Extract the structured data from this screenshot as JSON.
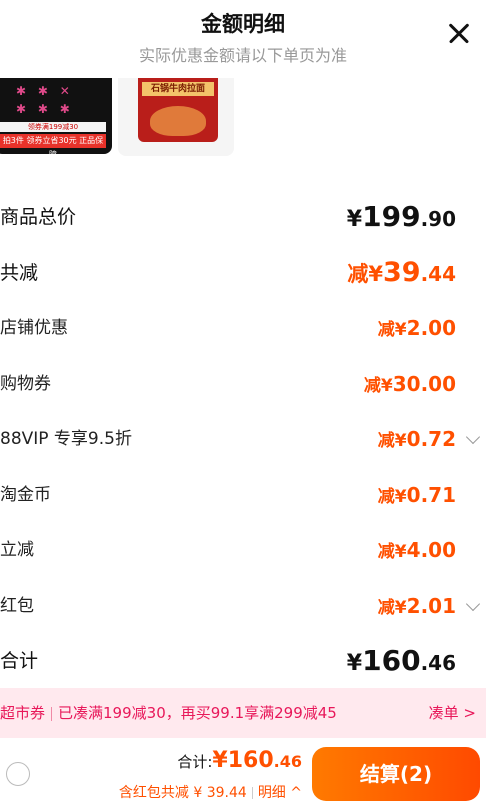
{
  "header": {
    "title": "金额明细",
    "subtitle": "实际优惠金额请以下单页为准"
  },
  "thumbnails": [
    {
      "banner": "领券满199减30",
      "badge": "拍3件 领券立省30元 正品保障"
    },
    {
      "label": "石锅牛肉拉面"
    }
  ],
  "rows": [
    {
      "label": "商品总价",
      "prefix": "¥",
      "int": "199",
      "dec": ".90"
    },
    {
      "label": "共减",
      "prefix": "减¥",
      "int": "39",
      "dec": ".44"
    },
    {
      "label": "店铺优惠",
      "prefix": "减¥",
      "int": "2",
      "dec": ".00"
    },
    {
      "label": "购物券",
      "prefix": "减¥",
      "int": "30",
      "dec": ".00"
    },
    {
      "label": "88VIP 专享9.5折",
      "prefix": "减¥",
      "int": "0",
      "dec": ".72"
    },
    {
      "label": "淘金币",
      "prefix": "减¥",
      "int": "0",
      "dec": ".71"
    },
    {
      "label": "立减",
      "prefix": "减¥",
      "int": "4",
      "dec": ".00"
    },
    {
      "label": "红包",
      "prefix": "减¥",
      "int": "2",
      "dec": ".01"
    },
    {
      "label": "合计",
      "prefix": "¥",
      "int": "160",
      "dec": ".46"
    }
  ],
  "promo": {
    "tag": "超市券",
    "text": "已凑满199减30，再买99.1享满299减45",
    "link": "凑单 >"
  },
  "footer": {
    "total_label": "合计:",
    "total_prefix": "¥",
    "total_int": "160",
    "total_dec": ".46",
    "redpack_text": "含红包共减 ¥ 39.44",
    "detail_link": "明细 ^",
    "checkout": "结算(2)"
  },
  "colors": {
    "accent": "#ff5000",
    "promo_bg": "#ffe9ee",
    "promo_text": "#e8185a"
  }
}
